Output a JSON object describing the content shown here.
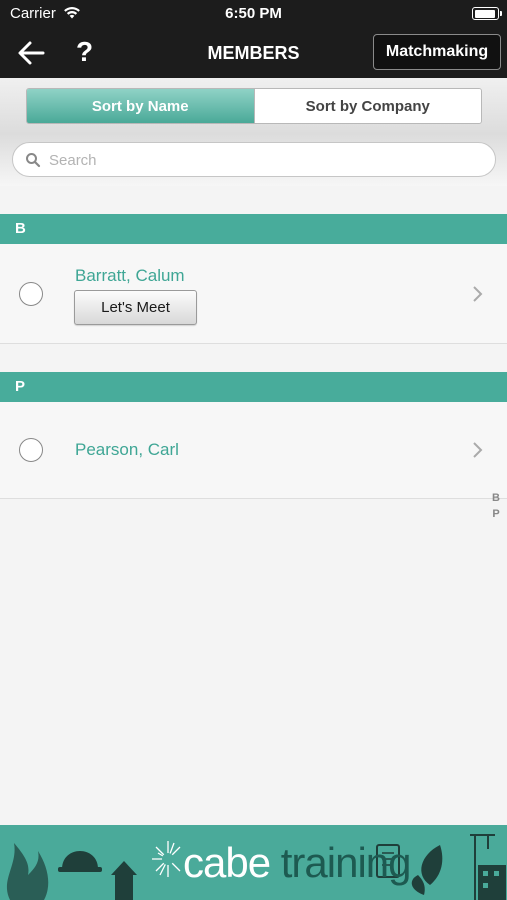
{
  "status_bar": {
    "carrier": "Carrier",
    "time": "6:50 PM",
    "battery_level": 0.95
  },
  "nav": {
    "title": "MEMBERS",
    "help_label": "?",
    "matchmaking_label": "Matchmaking"
  },
  "sort": {
    "options": [
      "Sort by Name",
      "Sort by Company"
    ],
    "selected": "Sort by Name"
  },
  "search": {
    "placeholder": "Search",
    "value": ""
  },
  "sections": [
    {
      "letter": "B",
      "members": [
        {
          "name": "Barratt, Calum",
          "action_label": "Let's Meet"
        }
      ]
    },
    {
      "letter": "P",
      "members": [
        {
          "name": "Pearson, Carl"
        }
      ]
    }
  ],
  "index_letters": [
    "B",
    "P"
  ],
  "footer": {
    "brand_part1": "cabe",
    "brand_part2": "training"
  },
  "colors": {
    "accent": "#48ac9b",
    "nav_background": "#1c1c1c",
    "member_name": "#3fa695"
  },
  "icons": [
    "back-arrow-icon",
    "wifi-icon",
    "battery-icon",
    "search-icon",
    "chevron-right-icon",
    "radio-circle-icon"
  ]
}
